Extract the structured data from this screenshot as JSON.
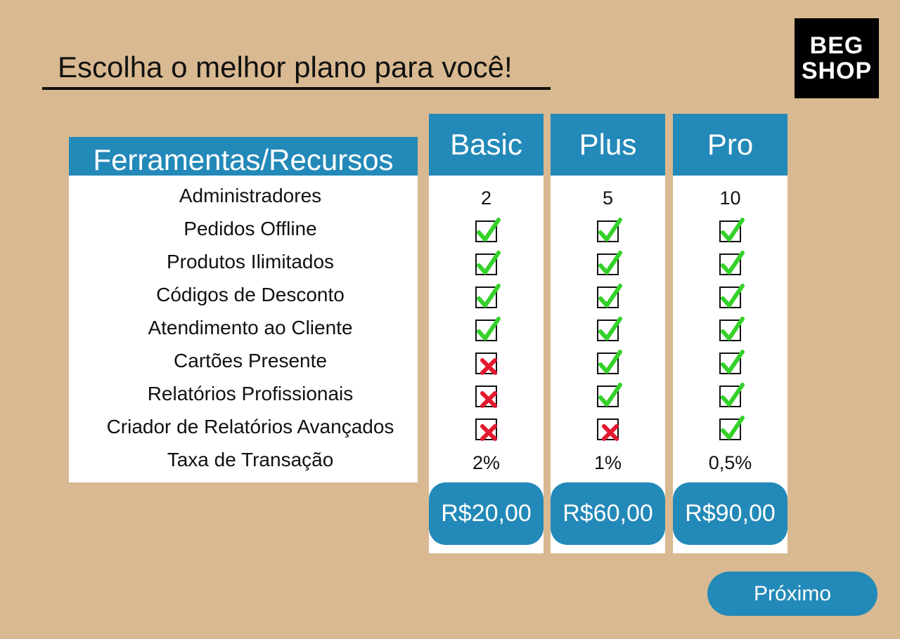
{
  "page": {
    "title": "Escolha o melhor plano para você!",
    "logo": {
      "line1": "BEG",
      "line2": "SHOP"
    }
  },
  "features": {
    "header": "Ferramentas/Recursos",
    "items": [
      "Administradores",
      "Pedidos Offline",
      "Produtos Ilimitados",
      "Códigos de Desconto",
      "Atendimento ao Cliente",
      "Cartões Presente",
      "Relatórios Profissionais",
      "Criador de Relatórios Avançados",
      "Taxa de Transação"
    ]
  },
  "plans": [
    {
      "name": "Basic",
      "admins": "2",
      "checks": [
        true,
        true,
        true,
        true,
        false,
        false,
        false
      ],
      "fee": "2%",
      "price": "R$20,00"
    },
    {
      "name": "Plus",
      "admins": "5",
      "checks": [
        true,
        true,
        true,
        true,
        true,
        true,
        false
      ],
      "fee": "1%",
      "price": "R$60,00"
    },
    {
      "name": "Pro",
      "admins": "10",
      "checks": [
        true,
        true,
        true,
        true,
        true,
        true,
        true
      ],
      "fee": "0,5%",
      "price": "R$90,00"
    }
  ],
  "actions": {
    "next_label": "Próximo"
  },
  "colors": {
    "background": "#d9b991",
    "accent": "#2389b8",
    "check": "#35d12a",
    "cross": "#e3182f"
  }
}
